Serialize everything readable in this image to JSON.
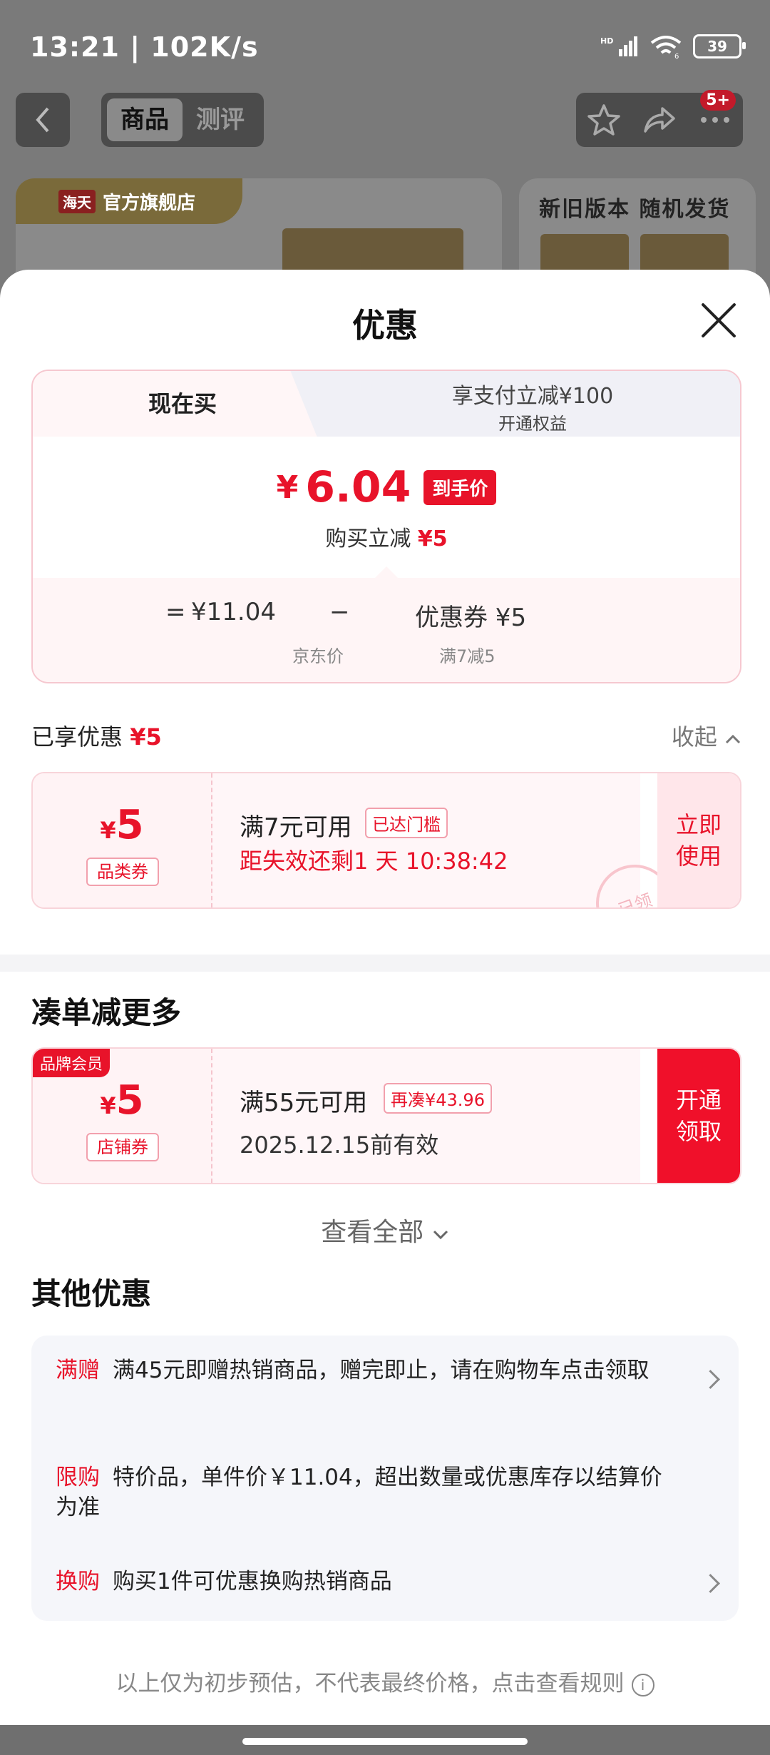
{
  "status": {
    "time": "13:21 | 102K/s",
    "battery": "39",
    "signal": "HD",
    "network": "6"
  },
  "topbar": {
    "tabs": [
      "商品",
      "测评"
    ],
    "badge": "5+"
  },
  "background": {
    "shop_logo": "海天",
    "shop_name": "官方旗舰店",
    "right_title": "新旧版本 随机发货"
  },
  "sheet": {
    "title": "优惠",
    "tab_now": "现在买",
    "tab_pay_title": "享支付立减¥100",
    "tab_pay_sub": "开通权益",
    "price_yen": "¥",
    "price_value": "6.04",
    "price_tag": "到手价",
    "reduce_label": "购买立减",
    "reduce_value": "¥5",
    "calc": {
      "eq": "=",
      "jd_price": "¥11.04",
      "minus": "−",
      "coupon": "优惠券 ¥5",
      "jd_label": "京东价",
      "coupon_cond": "满7减5"
    },
    "enjoyed_label": "已享优惠",
    "enjoyed_value": "¥5",
    "collapse": "收起"
  },
  "coupon1": {
    "yen": "¥",
    "amount": "5",
    "type": "品类券",
    "condition": "满7元可用",
    "pill": "已达门槛",
    "expire": "距失效还剩1 天 10:38:42",
    "action": "立即\n使用",
    "stamp": "已领"
  },
  "section_more": "凑单减更多",
  "coupon2": {
    "tag": "品牌会员",
    "yen": "¥",
    "amount": "5",
    "type": "店铺券",
    "condition": "满55元可用",
    "pill": "再凑¥43.96",
    "valid": "2025.12.15前有效",
    "action": "开通\n领取"
  },
  "view_all": "查看全部",
  "section_other": "其他优惠",
  "others": [
    {
      "label": "满赠",
      "text": "满45元即赠热销商品，赠完即止，请在购物车点击领取"
    },
    {
      "label": "限购",
      "text": "特价品，单件价￥11.04，超出数量或优惠库存以结算价为准"
    },
    {
      "label": "换购",
      "text": "购买1件可优惠换购热销商品"
    }
  ],
  "footer_note": "以上仅为初步预估，不代表最终价格，点击查看规则",
  "colors": {
    "accent": "#e8132a",
    "pink_bg": "#fff3f5"
  }
}
